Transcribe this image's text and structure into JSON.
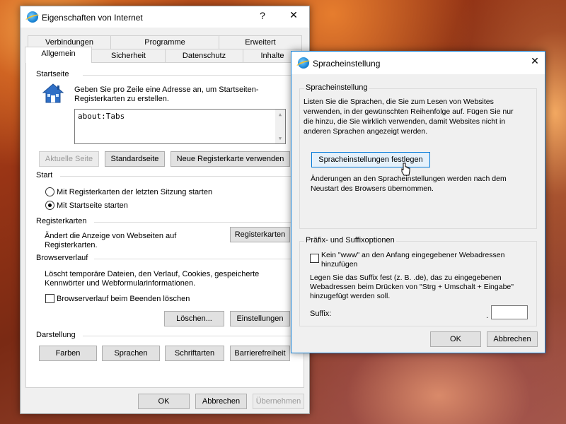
{
  "main_window": {
    "title": "Eigenschaften von Internet",
    "help_glyph": "?",
    "close_glyph": "✕",
    "tabs_row1": [
      "Verbindungen",
      "Programme",
      "Erweitert"
    ],
    "tabs_row2": [
      "Allgemein",
      "Sicherheit",
      "Datenschutz",
      "Inhalte"
    ],
    "startseite": {
      "heading": "Startseite",
      "description_line1": "Geben Sie pro Zeile eine Adresse an, um Startseiten-",
      "description_line2": "Registerkarten zu erstellen.",
      "address_value": "about:Tabs",
      "btn_aktuelle": "Aktuelle Seite",
      "btn_standard": "Standardseite",
      "btn_neue": "Neue Registerkarte verwenden"
    },
    "start": {
      "heading": "Start",
      "option1": "Mit Registerkarten der letzten Sitzung starten",
      "option2": "Mit Startseite starten",
      "selected": 2
    },
    "registerkarten": {
      "heading": "Registerkarten",
      "description_line1": "Ändert die Anzeige von Webseiten auf",
      "description_line2": "Registerkarten.",
      "button": "Registerkarten"
    },
    "browserverlauf": {
      "heading": "Browserverlauf",
      "description_line1": "Löscht temporäre Dateien, den Verlauf, Cookies, gespeicherte",
      "description_line2": "Kennwörter und Webformularinformationen.",
      "checkbox_label": "Browserverlauf beim Beenden löschen",
      "checked": false,
      "btn_loeschen": "Löschen...",
      "btn_einstellungen": "Einstellungen"
    },
    "darstellung": {
      "heading": "Darstellung",
      "btn_farben": "Farben",
      "btn_sprachen": "Sprachen",
      "btn_schriftarten": "Schriftarten",
      "btn_barriere": "Barrierefreiheit"
    },
    "footer": {
      "ok": "OK",
      "abbrechen": "Abbrechen",
      "uebernehmen": "Übernehmen"
    }
  },
  "dialog": {
    "title": "Spracheinstellung",
    "close_glyph": "✕",
    "sprach_group": {
      "heading": "Spracheinstellung",
      "desc_line1": "Listen Sie die Sprachen, die Sie zum Lesen von Websites",
      "desc_line2": "verwenden, in der gewünschten Reihenfolge auf. Fügen Sie nur",
      "desc_line3": "die hinzu, die Sie wirklich verwenden, damit Websites nicht in",
      "desc_line4": "anderen Sprachen angezeigt werden.",
      "button": "Spracheinstellungen festlegen",
      "note_line1": "Änderungen an den Spracheinstellungen werden nach dem",
      "note_line2": "Neustart des Browsers übernommen."
    },
    "praefix_group": {
      "heading": "Präfix- und Suffixoptionen",
      "checkbox_line1": "Kein \"www\" an den Anfang eingegebener Webadressen",
      "checkbox_line2": "hinzufügen",
      "checked": false,
      "desc_line1": "Legen Sie das Suffix fest (z. B. .de), das zu eingegebenen",
      "desc_line2": "Webadressen beim Drücken von \"Strg + Umschalt + Eingabe\"",
      "desc_line3": "hinzugefügt werden soll.",
      "suffix_label": "Suffix:",
      "suffix_dot": ".",
      "suffix_value": ""
    },
    "ok": "OK",
    "abbrechen": "Abbrechen"
  },
  "colors": {
    "accent": "#0078d7",
    "disabled_text": "#9a9a9a"
  }
}
